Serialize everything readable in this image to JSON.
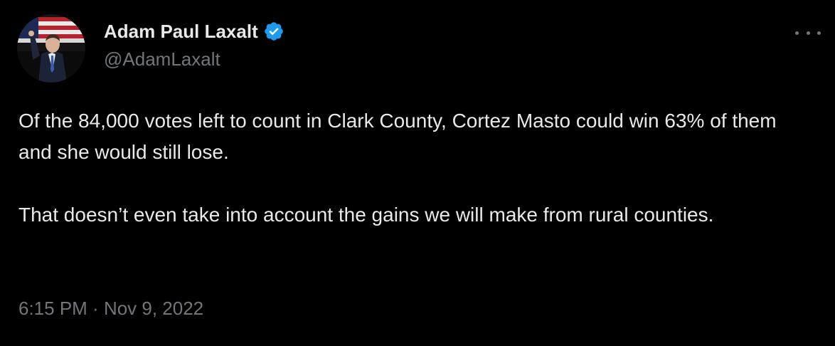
{
  "tweet": {
    "author": {
      "display_name": "Adam Paul Laxalt",
      "handle": "@AdamLaxalt",
      "verified": true,
      "avatar_icon": "profile-avatar"
    },
    "more_icon": "more-options-icon",
    "body": [
      "Of the 84,000 votes left to count in Clark County, Cortez Masto could win 63% of them and she would still lose.",
      "That doesn’t even take into account the gains we will make from rural counties."
    ],
    "time": "6:15 PM",
    "separator": " · ",
    "date": "Nov 9, 2022"
  },
  "colors": {
    "background": "#000000",
    "primary_text": "#e7e9ea",
    "secondary_text": "#71767b",
    "verified_badge": "#1d9bf0"
  }
}
